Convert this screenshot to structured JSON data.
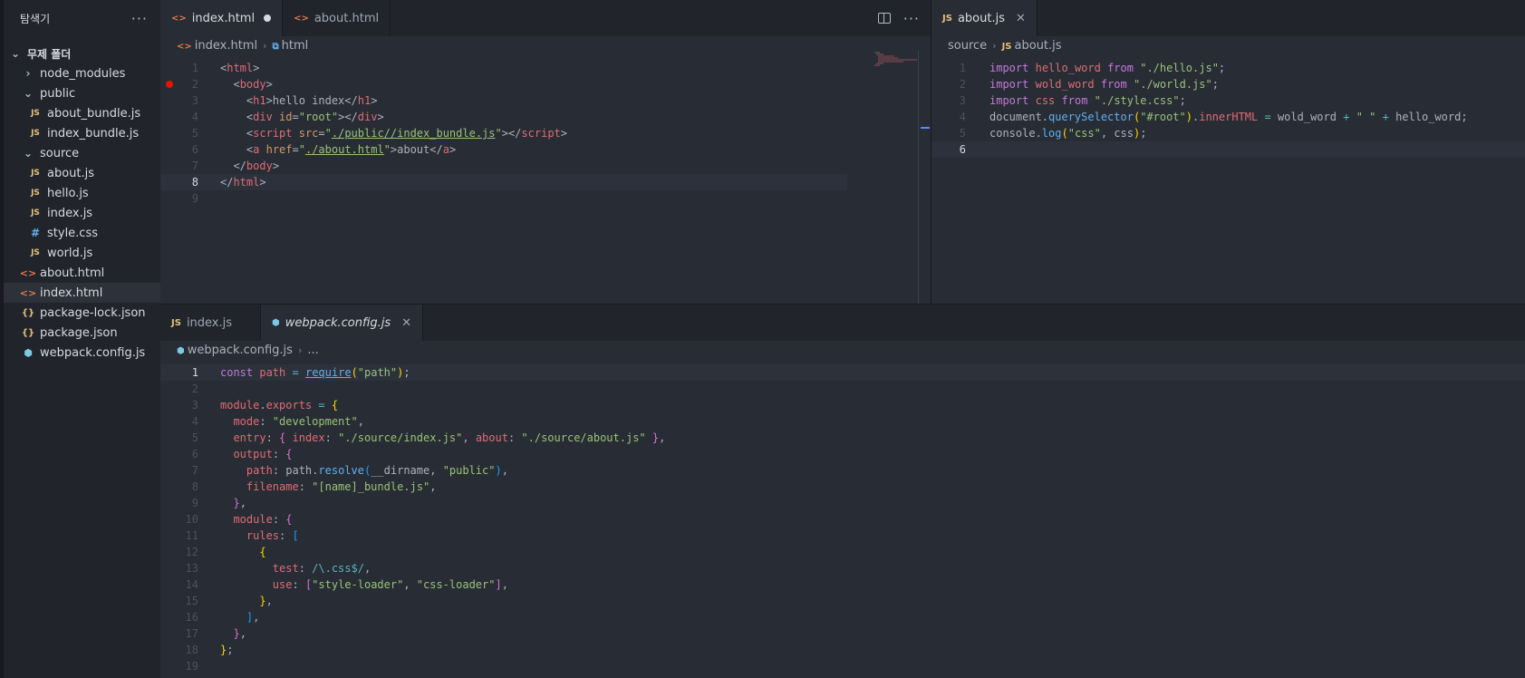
{
  "explorer": {
    "title": "탐색기",
    "more": "···",
    "folder": "무제 폴더",
    "items": [
      {
        "label": "node_modules",
        "kind": "folder-closed",
        "indent": 1
      },
      {
        "label": "public",
        "kind": "folder-open",
        "indent": 1
      },
      {
        "label": "about_bundle.js",
        "kind": "js",
        "indent": 2
      },
      {
        "label": "index_bundle.js",
        "kind": "js",
        "indent": 2
      },
      {
        "label": "source",
        "kind": "folder-open",
        "indent": 1
      },
      {
        "label": "about.js",
        "kind": "js",
        "indent": 2
      },
      {
        "label": "hello.js",
        "kind": "js",
        "indent": 2
      },
      {
        "label": "index.js",
        "kind": "js",
        "indent": 2
      },
      {
        "label": "style.css",
        "kind": "css",
        "indent": 2
      },
      {
        "label": "world.js",
        "kind": "js",
        "indent": 2
      },
      {
        "label": "about.html",
        "kind": "html",
        "indent": 1
      },
      {
        "label": "index.html",
        "kind": "html",
        "indent": 1,
        "active": true
      },
      {
        "label": "package-lock.json",
        "kind": "json",
        "indent": 1
      },
      {
        "label": "package.json",
        "kind": "json",
        "indent": 1
      },
      {
        "label": "webpack.config.js",
        "kind": "webpack",
        "indent": 1
      }
    ]
  },
  "icons": {
    "js": "JS",
    "html": "<>",
    "css": "#",
    "json": "{}",
    "webpack": "⬢",
    "folder-closed": "›",
    "folder-open": "⌄"
  },
  "groups": {
    "top_left": {
      "tabs": [
        {
          "label": "index.html",
          "icon": "html",
          "active": true,
          "dirty": true
        },
        {
          "label": "about.html",
          "icon": "html",
          "active": false
        }
      ],
      "breadcrumb": [
        "index.html",
        "html"
      ],
      "current_line": 8,
      "breakpoint_line": 2,
      "lines": [
        [
          [
            "pun",
            "<"
          ],
          [
            "tag",
            "html"
          ],
          [
            "pun",
            ">"
          ]
        ],
        [
          [
            "pun",
            "  <"
          ],
          [
            "tag",
            "body"
          ],
          [
            "pun",
            ">"
          ]
        ],
        [
          [
            "pun",
            "    <"
          ],
          [
            "tag",
            "h1"
          ],
          [
            "pun",
            ">hello index</"
          ],
          [
            "tag",
            "h1"
          ],
          [
            "pun",
            ">"
          ]
        ],
        [
          [
            "pun",
            "    <"
          ],
          [
            "tag",
            "div"
          ],
          [
            "pun",
            " "
          ],
          [
            "attr",
            "id"
          ],
          [
            "pun",
            "="
          ],
          [
            "str",
            "\"root\""
          ],
          [
            "pun",
            "></"
          ],
          [
            "tag",
            "div"
          ],
          [
            "pun",
            ">"
          ]
        ],
        [
          [
            "pun",
            "    <"
          ],
          [
            "tag",
            "script"
          ],
          [
            "pun",
            " "
          ],
          [
            "attr",
            "src"
          ],
          [
            "pun",
            "="
          ],
          [
            "str",
            "\""
          ],
          [
            "str-lnk",
            "./public//index_bundle.js"
          ],
          [
            "str",
            "\""
          ],
          [
            "pun",
            "></"
          ],
          [
            "tag",
            "script"
          ],
          [
            "pun",
            ">"
          ]
        ],
        [
          [
            "pun",
            "    <"
          ],
          [
            "tag",
            "a"
          ],
          [
            "pun",
            " "
          ],
          [
            "attr",
            "href"
          ],
          [
            "pun",
            "="
          ],
          [
            "str",
            "\""
          ],
          [
            "str-lnk",
            "./about.html"
          ],
          [
            "str",
            "\""
          ],
          [
            "pun",
            ">about</"
          ],
          [
            "tag",
            "a"
          ],
          [
            "pun",
            ">"
          ]
        ],
        [
          [
            "pun",
            "  </"
          ],
          [
            "tag",
            "body"
          ],
          [
            "pun",
            ">"
          ]
        ],
        [
          [
            "pun",
            "</"
          ],
          [
            "tag",
            "html"
          ],
          [
            "pun",
            ">"
          ]
        ],
        []
      ]
    },
    "top_right": {
      "tabs": [
        {
          "label": "about.js",
          "icon": "js",
          "active": true,
          "closable": true
        }
      ],
      "breadcrumb": [
        "source",
        "about.js"
      ],
      "current_line": 6,
      "lines": [
        [
          [
            "kw",
            "import"
          ],
          [
            "pun",
            " "
          ],
          [
            "prop",
            "hello_word"
          ],
          [
            "pun",
            " "
          ],
          [
            "kw",
            "from"
          ],
          [
            "pun",
            " "
          ],
          [
            "str",
            "\"./hello.js\""
          ],
          [
            "pun",
            ";"
          ]
        ],
        [
          [
            "kw",
            "import"
          ],
          [
            "pun",
            " "
          ],
          [
            "prop",
            "wold_word"
          ],
          [
            "pun",
            " "
          ],
          [
            "kw",
            "from"
          ],
          [
            "pun",
            " "
          ],
          [
            "str",
            "\"./world.js\""
          ],
          [
            "pun",
            ";"
          ]
        ],
        [
          [
            "kw",
            "import"
          ],
          [
            "pun",
            " "
          ],
          [
            "prop",
            "css"
          ],
          [
            "pun",
            " "
          ],
          [
            "kw",
            "from"
          ],
          [
            "pun",
            " "
          ],
          [
            "str",
            "\"./style.css\""
          ],
          [
            "pun",
            ";"
          ]
        ],
        [
          [
            "pun",
            "document."
          ],
          [
            "fn",
            "querySelector"
          ],
          [
            "brk",
            "("
          ],
          [
            "str",
            "\"#root\""
          ],
          [
            "brk",
            ")"
          ],
          [
            "pun",
            "."
          ],
          [
            "prop",
            "innerHTML"
          ],
          [
            "pun",
            " "
          ],
          [
            "op",
            "="
          ],
          [
            "pun",
            " wold_word "
          ],
          [
            "op",
            "+"
          ],
          [
            "pun",
            " "
          ],
          [
            "str",
            "\" \""
          ],
          [
            "pun",
            " "
          ],
          [
            "op",
            "+"
          ],
          [
            "pun",
            " hello_word;"
          ]
        ],
        [
          [
            "pun",
            "console."
          ],
          [
            "fn",
            "log"
          ],
          [
            "brk",
            "("
          ],
          [
            "str",
            "\"css\""
          ],
          [
            "pun",
            ", css"
          ],
          [
            "brk",
            ")"
          ],
          [
            "pun",
            ";"
          ]
        ],
        []
      ]
    },
    "bottom": {
      "tabs": [
        {
          "label": "index.js",
          "icon": "js",
          "active": false
        },
        {
          "label": "webpack.config.js",
          "icon": "webpack",
          "active": true,
          "italic": true,
          "closable": true
        }
      ],
      "breadcrumb": [
        "webpack.config.js",
        "..."
      ],
      "current_line": 1,
      "lines": [
        [
          [
            "kw",
            "const"
          ],
          [
            "pun",
            " "
          ],
          [
            "prop",
            "path"
          ],
          [
            "pun",
            " "
          ],
          [
            "op",
            "="
          ],
          [
            "pun",
            " "
          ],
          [
            "fn-lnk",
            "require"
          ],
          [
            "brk",
            "("
          ],
          [
            "str",
            "\"path\""
          ],
          [
            "brk",
            ")"
          ],
          [
            "pun",
            ";"
          ]
        ],
        [],
        [
          [
            "prop",
            "module"
          ],
          [
            "pun",
            "."
          ],
          [
            "prop",
            "exports"
          ],
          [
            "pun",
            " "
          ],
          [
            "op",
            "="
          ],
          [
            "pun",
            " "
          ],
          [
            "brk",
            "{"
          ]
        ],
        [
          [
            "pun",
            "  "
          ],
          [
            "prop",
            "mode"
          ],
          [
            "pun",
            ": "
          ],
          [
            "str",
            "\"development\""
          ],
          [
            "pun",
            ","
          ]
        ],
        [
          [
            "pun",
            "  "
          ],
          [
            "prop",
            "entry"
          ],
          [
            "pun",
            ": "
          ],
          [
            "brk2",
            "{"
          ],
          [
            "pun",
            " "
          ],
          [
            "prop",
            "index"
          ],
          [
            "pun",
            ": "
          ],
          [
            "str",
            "\"./source/index.js\""
          ],
          [
            "pun",
            ", "
          ],
          [
            "prop",
            "about"
          ],
          [
            "pun",
            ": "
          ],
          [
            "str",
            "\"./source/about.js\""
          ],
          [
            "pun",
            " "
          ],
          [
            "brk2",
            "}"
          ],
          [
            "pun",
            ","
          ]
        ],
        [
          [
            "pun",
            "  "
          ],
          [
            "prop",
            "output"
          ],
          [
            "pun",
            ": "
          ],
          [
            "brk2",
            "{"
          ]
        ],
        [
          [
            "pun",
            "    "
          ],
          [
            "prop",
            "path"
          ],
          [
            "pun",
            ": path."
          ],
          [
            "fn",
            "resolve"
          ],
          [
            "brk3",
            "("
          ],
          [
            "pun",
            "__dirname, "
          ],
          [
            "str",
            "\"public\""
          ],
          [
            "brk3",
            ")"
          ],
          [
            "pun",
            ","
          ]
        ],
        [
          [
            "pun",
            "    "
          ],
          [
            "prop",
            "filename"
          ],
          [
            "pun",
            ": "
          ],
          [
            "str",
            "\"[name]_bundle.js\""
          ],
          [
            "pun",
            ","
          ]
        ],
        [
          [
            "pun",
            "  "
          ],
          [
            "brk2",
            "}"
          ],
          [
            "pun",
            ","
          ]
        ],
        [
          [
            "pun",
            "  "
          ],
          [
            "prop",
            "module"
          ],
          [
            "pun",
            ": "
          ],
          [
            "brk2",
            "{"
          ]
        ],
        [
          [
            "pun",
            "    "
          ],
          [
            "prop",
            "rules"
          ],
          [
            "pun",
            ": "
          ],
          [
            "brk3",
            "["
          ]
        ],
        [
          [
            "pun",
            "      "
          ],
          [
            "brk",
            "{"
          ]
        ],
        [
          [
            "pun",
            "        "
          ],
          [
            "prop",
            "test"
          ],
          [
            "pun",
            ": "
          ],
          [
            "rx",
            "/\\.css$/"
          ],
          [
            "pun",
            ","
          ]
        ],
        [
          [
            "pun",
            "        "
          ],
          [
            "prop",
            "use"
          ],
          [
            "pun",
            ": "
          ],
          [
            "brk2",
            "["
          ],
          [
            "str",
            "\"style-loader\""
          ],
          [
            "pun",
            ", "
          ],
          [
            "str",
            "\"css-loader\""
          ],
          [
            "brk2",
            "]"
          ],
          [
            "pun",
            ","
          ]
        ],
        [
          [
            "pun",
            "      "
          ],
          [
            "brk",
            "}"
          ],
          [
            "pun",
            ","
          ]
        ],
        [
          [
            "pun",
            "    "
          ],
          [
            "brk3",
            "]"
          ],
          [
            "pun",
            ","
          ]
        ],
        [
          [
            "pun",
            "  "
          ],
          [
            "brk2",
            "}"
          ],
          [
            "pun",
            ","
          ]
        ],
        [
          [
            "brk",
            "}"
          ],
          [
            "pun",
            ";"
          ]
        ],
        []
      ]
    }
  }
}
